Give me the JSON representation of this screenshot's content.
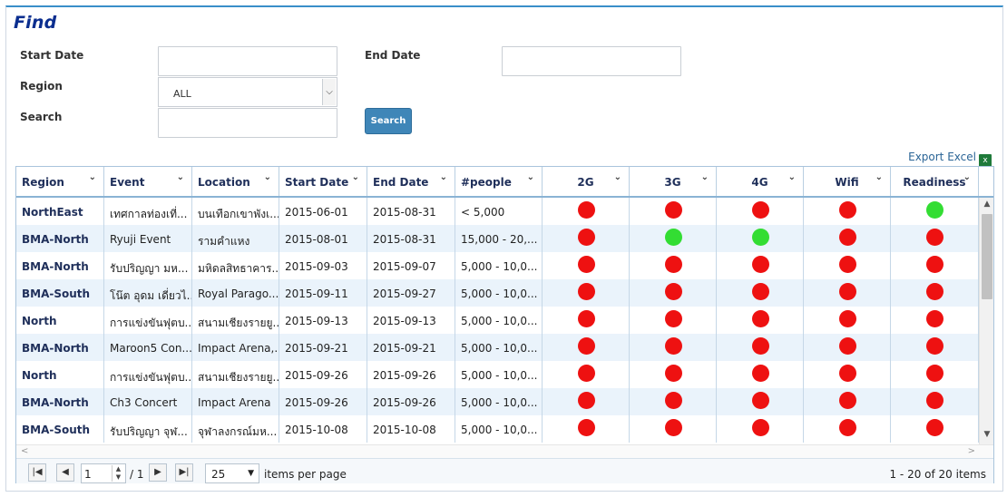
{
  "find": {
    "title": "Find",
    "start_date_label": "Start Date",
    "start_date_value": "",
    "end_date_label": "End Date",
    "end_date_value": "",
    "region_label": "Region",
    "region_value": "ALL",
    "search_label": "Search",
    "search_value": "",
    "search_button": "Search"
  },
  "export_label": "Export Excel",
  "columns": [
    "Region",
    "Event",
    "Location",
    "Start Date",
    "End Date",
    "#people",
    "2G",
    "3G",
    "4G",
    "Wifi",
    "Readiness"
  ],
  "rows": [
    {
      "region": "NorthEast",
      "event": "เทศกาลท่องเที่...",
      "location": "บนเทือกเขาพังเ...",
      "start": "2015-06-01",
      "end": "2015-08-31",
      "people": "< 5,000",
      "g2": "red",
      "g3": "red",
      "g4": "red",
      "wifi": "red",
      "ready": "green"
    },
    {
      "region": "BMA-North",
      "event": "Ryuji Event",
      "location": "รามคำแหง",
      "start": "2015-08-01",
      "end": "2015-08-31",
      "people": "15,000 - 20,...",
      "g2": "red",
      "g3": "green",
      "g4": "green",
      "wifi": "red",
      "ready": "red"
    },
    {
      "region": "BMA-North",
      "event": "รับปริญญา มห...",
      "location": "มหิดลสิทธาคาร...",
      "start": "2015-09-03",
      "end": "2015-09-07",
      "people": "5,000 - 10,0...",
      "g2": "red",
      "g3": "red",
      "g4": "red",
      "wifi": "red",
      "ready": "red"
    },
    {
      "region": "BMA-South",
      "event": "โน๊ต อุดม เดี่ยวไ...",
      "location": "Royal Parago...",
      "start": "2015-09-11",
      "end": "2015-09-27",
      "people": "5,000 - 10,0...",
      "g2": "red",
      "g3": "red",
      "g4": "red",
      "wifi": "red",
      "ready": "red"
    },
    {
      "region": "North",
      "event": "การแข่งขันฟุตบ...",
      "location": "สนามเชียงรายยู...",
      "start": "2015-09-13",
      "end": "2015-09-13",
      "people": "5,000 - 10,0...",
      "g2": "red",
      "g3": "red",
      "g4": "red",
      "wifi": "red",
      "ready": "red"
    },
    {
      "region": "BMA-North",
      "event": "Maroon5 Con...",
      "location": "Impact Arena,...",
      "start": "2015-09-21",
      "end": "2015-09-21",
      "people": "5,000 - 10,0...",
      "g2": "red",
      "g3": "red",
      "g4": "red",
      "wifi": "red",
      "ready": "red"
    },
    {
      "region": "North",
      "event": "การแข่งขันฟุตบ...",
      "location": "สนามเชียงรายยู...",
      "start": "2015-09-26",
      "end": "2015-09-26",
      "people": "5,000 - 10,0...",
      "g2": "red",
      "g3": "red",
      "g4": "red",
      "wifi": "red",
      "ready": "red"
    },
    {
      "region": "BMA-North",
      "event": "Ch3 Concert",
      "location": "Impact Arena",
      "start": "2015-09-26",
      "end": "2015-09-26",
      "people": "5,000 - 10,0...",
      "g2": "red",
      "g3": "red",
      "g4": "red",
      "wifi": "red",
      "ready": "red"
    },
    {
      "region": "BMA-South",
      "event": "รับปริญญา จุฬ...",
      "location": "จุฬาลงกรณ์มห...",
      "start": "2015-10-08",
      "end": "2015-10-08",
      "people": "5,000 - 10,0...",
      "g2": "red",
      "g3": "red",
      "g4": "red",
      "wifi": "red",
      "ready": "red"
    }
  ],
  "colors": {
    "red": "#ee1111",
    "green": "#33dd33"
  },
  "pager": {
    "page_value": "1",
    "page_total": "/ 1",
    "page_size": "25",
    "items_per_page": "items per page",
    "summary": "1 - 20 of 20 items"
  }
}
